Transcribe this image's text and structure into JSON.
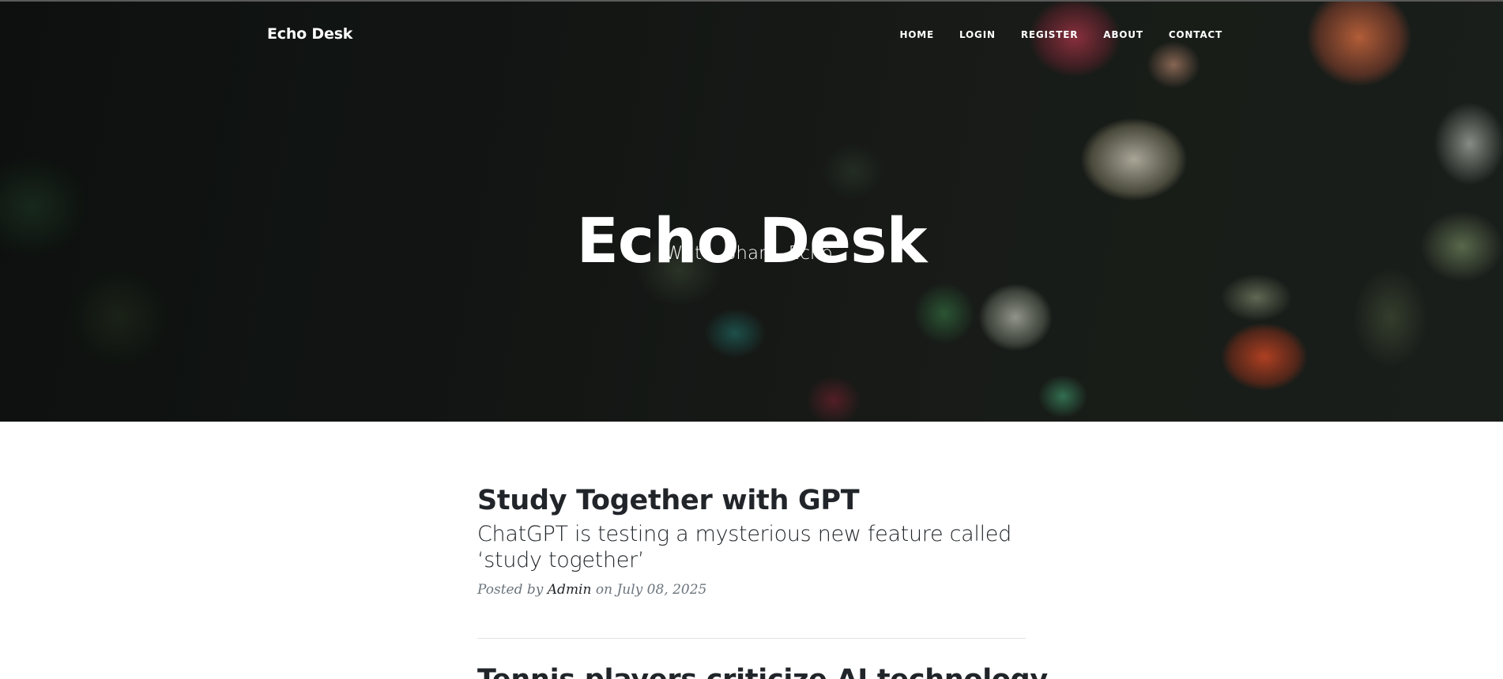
{
  "navbar": {
    "brand": "Echo Desk",
    "links": [
      "HOME",
      "LOGIN",
      "REGISTER",
      "ABOUT",
      "CONTACT"
    ]
  },
  "hero": {
    "title": "Echo Desk",
    "subtitle": "Write. Share. Echo."
  },
  "posts": [
    {
      "title": "Study Together with GPT",
      "subtitle": "ChatGPT is testing a mysterious new feature called ‘study together’",
      "posted_by_label": "Posted by",
      "author": "Admin",
      "date_prefix": "on",
      "date": "July 08, 2025"
    },
    {
      "title": "Tennis players criticize AI technology"
    }
  ],
  "colors": {
    "text": "#212529",
    "meta": "#6c757d",
    "divider": "#e3e3e3"
  }
}
